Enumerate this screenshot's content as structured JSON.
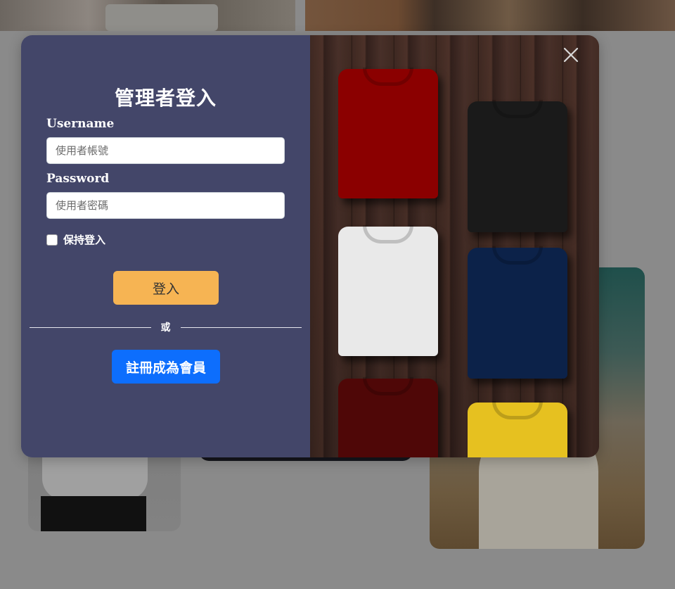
{
  "login_modal": {
    "title": "管理者登入",
    "username_label": "Username",
    "username_placeholder": "使用者帳號",
    "password_label": "Password",
    "password_placeholder": "使用者密碼",
    "remember_label": "保持登入",
    "remember_checked": false,
    "login_button": "登入",
    "divider_text": "或",
    "register_button": "註冊成為會員"
  },
  "icons": {
    "close": "close-icon"
  },
  "colors": {
    "panel_bg": "#434669",
    "login_button": "#f6b453",
    "register_button": "#0d6efd",
    "overlay": "#8a8a8a"
  },
  "showcase_image": {
    "shirt_colors": [
      "red",
      "black",
      "white",
      "navy",
      "maroon",
      "yellow"
    ]
  }
}
